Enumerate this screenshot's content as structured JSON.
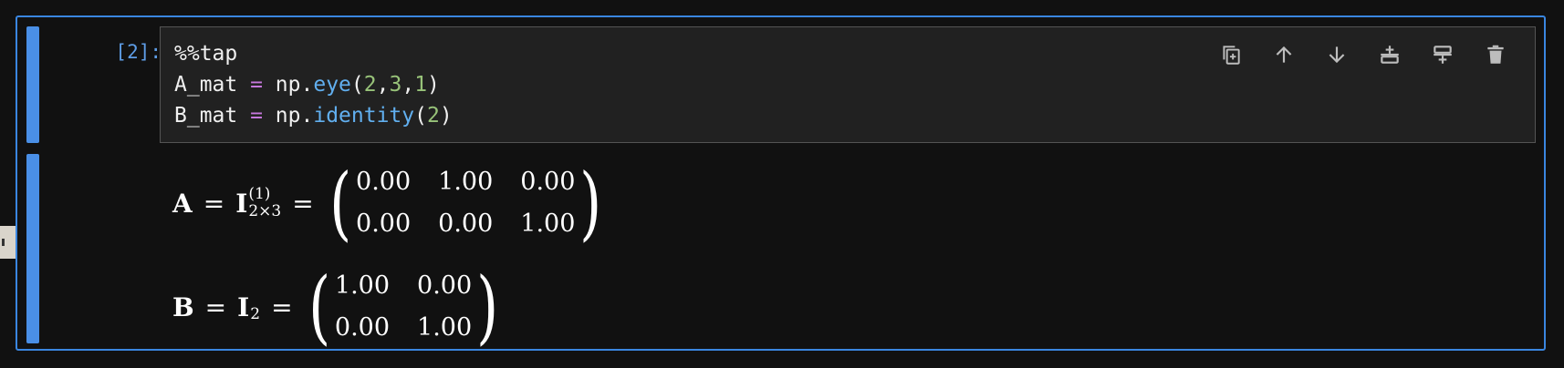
{
  "cell": {
    "prompt": "[2]:",
    "code_lines": [
      [
        {
          "t": "%%tap",
          "c": ""
        }
      ],
      [
        {
          "t": "A_mat ",
          "c": ""
        },
        {
          "t": "=",
          "c": "op"
        },
        {
          "t": " np.",
          "c": ""
        },
        {
          "t": "eye",
          "c": "fn"
        },
        {
          "t": "(",
          "c": ""
        },
        {
          "t": "2",
          "c": "num"
        },
        {
          "t": ",",
          "c": ""
        },
        {
          "t": "3",
          "c": "num"
        },
        {
          "t": ",",
          "c": ""
        },
        {
          "t": "1",
          "c": "num"
        },
        {
          "t": ")",
          "c": ""
        }
      ],
      [
        {
          "t": "B_mat ",
          "c": ""
        },
        {
          "t": "=",
          "c": "op"
        },
        {
          "t": " np.",
          "c": ""
        },
        {
          "t": "identity",
          "c": "fn"
        },
        {
          "t": "(",
          "c": ""
        },
        {
          "t": "2",
          "c": "num"
        },
        {
          "t": ")",
          "c": ""
        }
      ]
    ]
  },
  "toolbar": [
    {
      "name": "duplicate-cell-button",
      "icon": "duplicate-icon"
    },
    {
      "name": "move-up-button",
      "icon": "arrow-up-icon"
    },
    {
      "name": "move-down-button",
      "icon": "arrow-down-icon"
    },
    {
      "name": "insert-above-button",
      "icon": "insert-above-icon"
    },
    {
      "name": "insert-below-button",
      "icon": "insert-below-icon"
    },
    {
      "name": "delete-cell-button",
      "icon": "trash-icon"
    }
  ],
  "output": {
    "eq_a": {
      "lhs": "A",
      "sym": "I",
      "sup": "(1)",
      "sub": "2×3",
      "rows": [
        [
          "0.00",
          "1.00",
          "0.00"
        ],
        [
          "0.00",
          "0.00",
          "1.00"
        ]
      ]
    },
    "eq_b": {
      "lhs": "B",
      "sym": "I",
      "sub": "2",
      "rows": [
        [
          "1.00",
          "0.00"
        ],
        [
          "0.00",
          "1.00"
        ]
      ]
    },
    "equals": "="
  },
  "colors": {
    "accent": "#3a86e0",
    "collapser": "#4a8fe6",
    "keyword_op": "#c678dd",
    "function": "#61afef",
    "number": "#98c379"
  }
}
